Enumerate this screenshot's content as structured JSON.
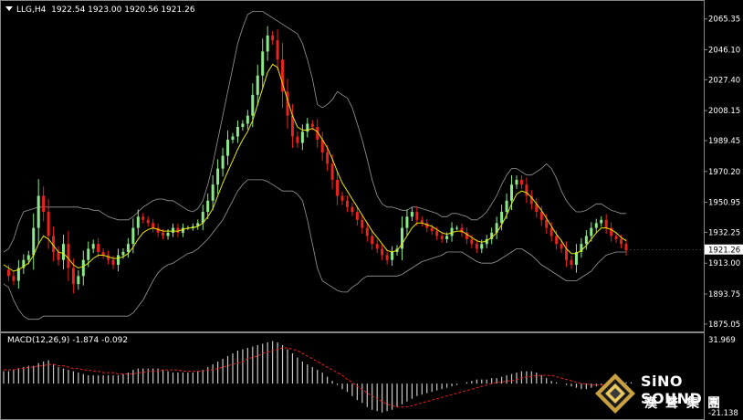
{
  "header": {
    "symbol": "LLG,H4",
    "ohlc": "1922.54 1923.00 1920.56 1921.26"
  },
  "macd": {
    "label": "MACD(12,26,9)",
    "main": "-1.874",
    "signal": "-0.092",
    "axis_ticks": [
      "31.969",
      "-21.138"
    ],
    "ylim": [
      -21.138,
      31.969
    ]
  },
  "price_axis": {
    "ticks": [
      "2065.35",
      "2046.10",
      "2027.40",
      "2008.15",
      "1989.45",
      "1970.20",
      "1950.95",
      "1932.25",
      "1913.00",
      "1893.75",
      "1875.05"
    ],
    "current_price": "1921.26",
    "ylim": [
      1871,
      2076
    ]
  },
  "colors": {
    "background": "#000000",
    "bull": "#8be88b",
    "bear": "#e8231c",
    "ma": "#e8e800",
    "bands": "#9a9a9a",
    "macd_hist": "#c8c8c8",
    "macd_signal": "#e8231c"
  },
  "chart_data": {
    "type": "line",
    "title": "LLG,H4",
    "xlabel": "",
    "ylabel": "",
    "ylim": [
      1871,
      2076
    ],
    "close_path": [
      1909,
      1905,
      1902,
      1910,
      1915,
      1918,
      1935,
      1955,
      1945,
      1930,
      1920,
      1915,
      1925,
      1910,
      1900,
      1905,
      1915,
      1922,
      1925,
      1920,
      1918,
      1915,
      1912,
      1918,
      1920,
      1925,
      1935,
      1942,
      1940,
      1938,
      1935,
      1932,
      1930,
      1932,
      1935,
      1932,
      1935,
      1935,
      1936,
      1938,
      1945,
      1952,
      1962,
      1972,
      1980,
      1990,
      1992,
      1998,
      2000,
      2005,
      2018,
      2030,
      2045,
      2055,
      2052,
      2040,
      2020,
      2005,
      1992,
      1988,
      1995,
      2000,
      1998,
      1990,
      1982,
      1975,
      1965,
      1955,
      1952,
      1948,
      1945,
      1940,
      1935,
      1930,
      1925,
      1922,
      1918,
      1915,
      1920,
      1922,
      1935,
      1942,
      1945,
      1940,
      1938,
      1935,
      1933,
      1930,
      1928,
      1930,
      1935,
      1935,
      1932,
      1928,
      1925,
      1922,
      1925,
      1928,
      1932,
      1938,
      1945,
      1952,
      1962,
      1965,
      1962,
      1955,
      1950,
      1945,
      1940,
      1935,
      1930,
      1925,
      1922,
      1915,
      1912,
      1920,
      1925,
      1930,
      1935,
      1938,
      1940,
      1935,
      1930,
      1928,
      1925,
      1921
    ],
    "ma_path": [
      1912,
      1910,
      1908,
      1909,
      1911,
      1913,
      1918,
      1925,
      1930,
      1928,
      1924,
      1920,
      1919,
      1916,
      1912,
      1910,
      1911,
      1913,
      1916,
      1918,
      1918,
      1917,
      1916,
      1916,
      1917,
      1919,
      1923,
      1928,
      1932,
      1934,
      1935,
      1934,
      1933,
      1933,
      1933,
      1933,
      1934,
      1935,
      1935,
      1936,
      1938,
      1942,
      1947,
      1955,
      1963,
      1970,
      1977,
      1984,
      1990,
      1995,
      2002,
      2012,
      2022,
      2032,
      2037,
      2035,
      2025,
      2015,
      2005,
      1998,
      1996,
      1996,
      1997,
      1995,
      1990,
      1985,
      1978,
      1970,
      1963,
      1958,
      1953,
      1948,
      1943,
      1938,
      1933,
      1929,
      1925,
      1921,
      1920,
      1921,
      1925,
      1930,
      1935,
      1938,
      1938,
      1937,
      1936,
      1934,
      1932,
      1931,
      1932,
      1933,
      1933,
      1931,
      1929,
      1927,
      1926,
      1927,
      1929,
      1932,
      1937,
      1943,
      1950,
      1956,
      1958,
      1957,
      1954,
      1950,
      1946,
      1941,
      1936,
      1931,
      1927,
      1922,
      1919,
      1919,
      1921,
      1924,
      1928,
      1932,
      1935,
      1935,
      1934,
      1932,
      1929,
      1927
    ],
    "band_upper": [
      1920,
      1922,
      1928,
      1938,
      1945,
      1946,
      1947,
      1948,
      1948,
      1948,
      1948,
      1948,
      1948,
      1948,
      1948,
      1948,
      1947,
      1947,
      1946,
      1946,
      1944,
      1942,
      1941,
      1940,
      1940,
      1940,
      1942,
      1945,
      1948,
      1950,
      1952,
      1953,
      1953,
      1952,
      1952,
      1950,
      1948,
      1946,
      1945,
      1947,
      1952,
      1962,
      1975,
      1990,
      2005,
      2020,
      2035,
      2050,
      2060,
      2068,
      2070,
      2070,
      2070,
      2068,
      2066,
      2064,
      2062,
      2060,
      2058,
      2056,
      2050,
      2040,
      2028,
      2012,
      2010,
      2012,
      2015,
      2020,
      2018,
      2016,
      2010,
      2000,
      1990,
      1978,
      1965,
      1955,
      1950,
      1948,
      1948,
      1947,
      1946,
      1946,
      1948,
      1948,
      1947,
      1946,
      1945,
      1944,
      1942,
      1942,
      1944,
      1944,
      1943,
      1942,
      1940,
      1940,
      1942,
      1945,
      1950,
      1955,
      1962,
      1968,
      1972,
      1972,
      1970,
      1968,
      1968,
      1970,
      1972,
      1975,
      1972,
      1966,
      1958,
      1952,
      1948,
      1945,
      1945,
      1946,
      1948,
      1950,
      1950,
      1948,
      1946,
      1945,
      1944,
      1944
    ],
    "band_lower": [
      1900,
      1898,
      1890,
      1884,
      1880,
      1878,
      1878,
      1878,
      1880,
      1880,
      1880,
      1880,
      1880,
      1880,
      1880,
      1880,
      1880,
      1880,
      1880,
      1880,
      1880,
      1880,
      1880,
      1880,
      1880,
      1880,
      1882,
      1886,
      1890,
      1896,
      1902,
      1907,
      1910,
      1912,
      1913,
      1915,
      1917,
      1919,
      1920,
      1922,
      1925,
      1928,
      1932,
      1936,
      1940,
      1946,
      1952,
      1958,
      1962,
      1965,
      1965,
      1965,
      1965,
      1964,
      1962,
      1960,
      1958,
      1958,
      1958,
      1956,
      1952,
      1940,
      1925,
      1910,
      1902,
      1900,
      1898,
      1896,
      1895,
      1895,
      1898,
      1900,
      1903,
      1905,
      1905,
      1905,
      1905,
      1905,
      1905,
      1905,
      1906,
      1908,
      1910,
      1912,
      1914,
      1915,
      1916,
      1917,
      1918,
      1920,
      1920,
      1920,
      1920,
      1918,
      1916,
      1914,
      1913,
      1913,
      1913,
      1914,
      1916,
      1918,
      1920,
      1922,
      1922,
      1920,
      1918,
      1915,
      1912,
      1910,
      1908,
      1906,
      1904,
      1902,
      1902,
      1902,
      1904,
      1906,
      1908,
      1912,
      1915,
      1918,
      1919,
      1920,
      1920,
      1920
    ],
    "macd_histogram": [
      9,
      9,
      10,
      11,
      12,
      13,
      13,
      15,
      16,
      17,
      14,
      12,
      11,
      10,
      9,
      8,
      7,
      6,
      6,
      6,
      6,
      6,
      6,
      6,
      7,
      8,
      10,
      11,
      11,
      11,
      11,
      11,
      10,
      9,
      8,
      8,
      8,
      8,
      8,
      9,
      10,
      12,
      14,
      16,
      18,
      20,
      22,
      24,
      25,
      26,
      27,
      28,
      29,
      30,
      31,
      30,
      28,
      25,
      22,
      19,
      16,
      14,
      12,
      10,
      8,
      5,
      2,
      -1,
      -4,
      -6,
      -9,
      -12,
      -14,
      -17,
      -19,
      -20,
      -21,
      -20,
      -19,
      -17,
      -15,
      -13,
      -11,
      -9,
      -8,
      -7,
      -6,
      -5,
      -4,
      -3,
      -2,
      -1,
      0,
      1,
      2,
      3,
      3,
      3,
      4,
      4,
      5,
      6,
      7,
      8,
      9,
      9,
      9,
      8,
      6,
      4,
      2,
      1,
      0,
      -1,
      -2,
      -3,
      -4,
      -4,
      -3,
      -2,
      -1,
      -1,
      0,
      1,
      1,
      1,
      1
    ],
    "macd_signal": [
      10,
      10,
      10,
      11,
      11,
      12,
      12,
      13,
      13,
      14,
      14,
      13,
      13,
      12,
      11,
      11,
      10,
      10,
      9,
      9,
      8,
      8,
      8,
      7,
      7,
      7,
      7,
      8,
      8,
      9,
      9,
      9,
      10,
      10,
      10,
      10,
      9,
      9,
      9,
      9,
      9,
      10,
      10,
      11,
      12,
      13,
      14,
      15,
      16,
      18,
      19,
      20,
      22,
      23,
      24,
      25,
      26,
      26,
      25,
      24,
      22,
      20,
      18,
      16,
      14,
      12,
      10,
      8,
      6,
      3,
      1,
      -2,
      -4,
      -7,
      -9,
      -11,
      -13,
      -15,
      -16,
      -17,
      -17,
      -17,
      -16,
      -15,
      -14,
      -13,
      -12,
      -11,
      -10,
      -9,
      -8,
      -7,
      -6,
      -5,
      -4,
      -3,
      -2,
      -1,
      0,
      1,
      1,
      2,
      2,
      3,
      4,
      5,
      5,
      6,
      6,
      6,
      6,
      5,
      4,
      3,
      2,
      1,
      0,
      0,
      -1,
      -1,
      -1,
      -1,
      -1,
      0,
      0,
      0
    ]
  }
}
